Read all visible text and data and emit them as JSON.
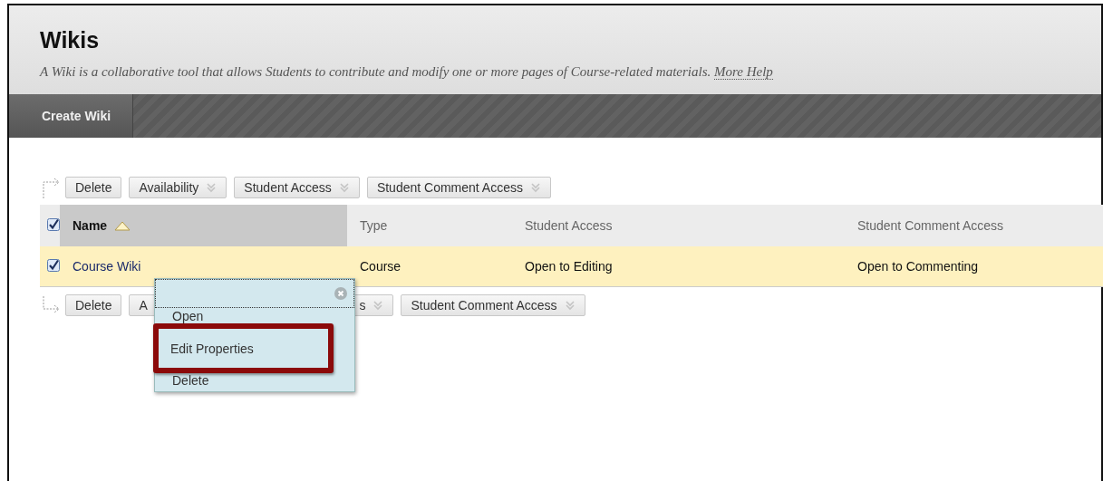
{
  "page": {
    "title": "Wikis",
    "description": "A Wiki is a collaborative tool that allows Students to contribute and modify one or more pages of Course-related materials.",
    "help_link": "More Help"
  },
  "action_bar": [
    {
      "label": "Create Wiki"
    }
  ],
  "toolbar_top": [
    {
      "label": "Delete",
      "dropdown": false
    },
    {
      "label": "Availability",
      "dropdown": true
    },
    {
      "label": "Student Access",
      "dropdown": true
    },
    {
      "label": "Student Comment Access",
      "dropdown": true
    }
  ],
  "table": {
    "select_all_checked": true,
    "columns": [
      {
        "label": "Name",
        "sorted": true
      },
      {
        "label": "Type",
        "sorted": false
      },
      {
        "label": "Student Access",
        "sorted": false
      },
      {
        "label": "Student Comment Access",
        "sorted": false
      }
    ],
    "rows": [
      {
        "checked": true,
        "cells": [
          "Course Wiki",
          "Course",
          "Open to Editing",
          "Open to Commenting"
        ]
      }
    ]
  },
  "toolbar_bottom": [
    {
      "label": "Delete",
      "dropdown": false
    },
    {
      "label": "A",
      "dropdown": false,
      "kind": "cut_right"
    },
    {
      "label": "s",
      "dropdown": true,
      "kind": "cut_left"
    },
    {
      "label": "Student Comment Access",
      "dropdown": true
    }
  ],
  "context_menu": {
    "items": [
      {
        "label": "Open",
        "highlighted": false
      },
      {
        "label": "Edit Properties",
        "highlighted": true
      },
      {
        "label": "Delete",
        "highlighted": false
      }
    ]
  }
}
